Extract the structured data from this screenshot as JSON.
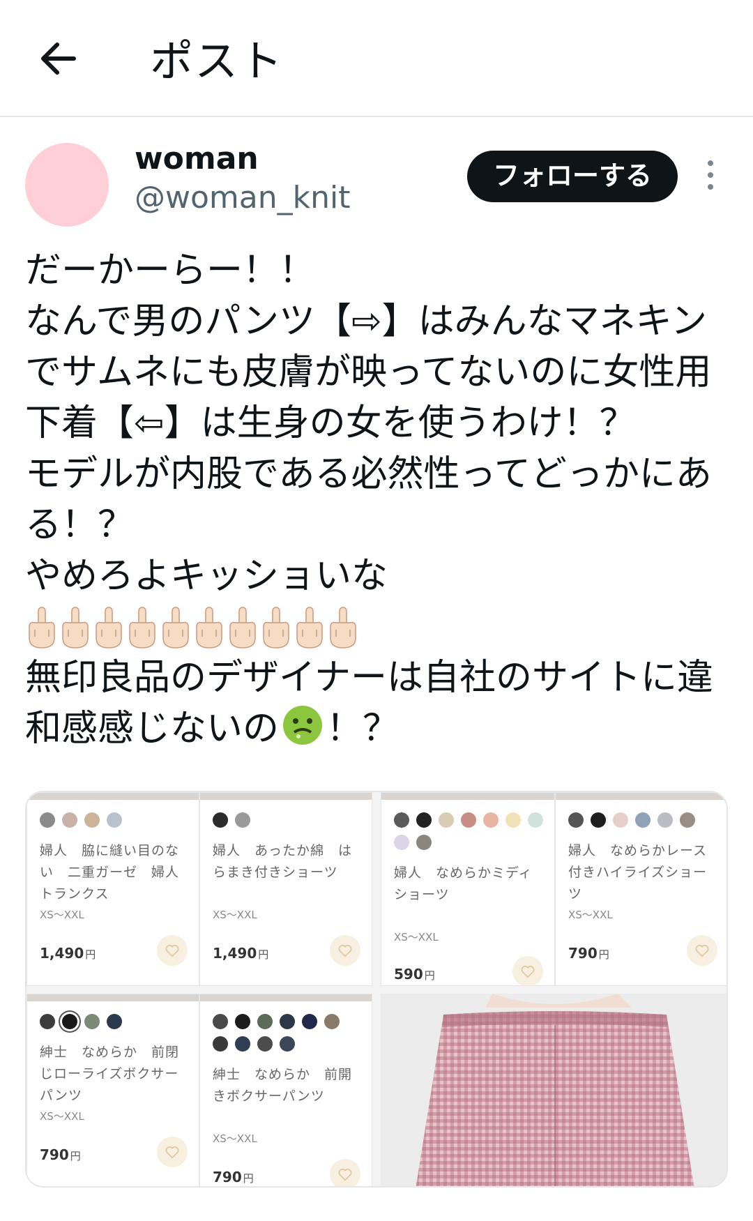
{
  "header": {
    "title": "ポスト",
    "back_icon": "arrow-left-icon"
  },
  "author": {
    "display_name": "woman",
    "handle": "@woman_knit",
    "avatar_color": "#ffcfd8"
  },
  "actions": {
    "follow_label": "フォローする",
    "more_icon": "more-vertical-icon"
  },
  "post": {
    "lines": [
      "だーかーらー！！",
      "なんで男のパンツ【⇨】はみんなマネキン",
      "でサムネにも皮膚が映ってないのに女性用",
      "下着【⇦】は生身の女を使うわけ！？",
      "モデルが内股である必然性ってどっかにあ",
      "る！？",
      "やめろよキッショいな"
    ],
    "emoji_line": "🖕🏻🖕🏻🖕🏻🖕🏻🖕🏻🖕🏻🖕🏻🖕🏻🖕🏻🖕🏻",
    "line_after_emoji": "無印良品のデザイナーは自社のサイトに違",
    "last_line_before": "和感感じないの",
    "last_line_emoji": "🤢",
    "last_line_after": "！？"
  },
  "media": {
    "products": [
      {
        "name": "婦人　脇に縫い目のない　二重ガーゼ　婦人トランクス",
        "size": "XS～XXL",
        "price": "1,490",
        "yen": "円",
        "swatches": [
          "#8a8a8a",
          "#c9b2a8",
          "#cdb59b",
          "#b9c2cf"
        ]
      },
      {
        "name": "婦人　あったか綿　はらまき付きショーツ",
        "size": "XS～XXL",
        "price": "1,490",
        "yen": "円",
        "swatches": [
          "#2b2b2b",
          "#9a9a9a"
        ]
      },
      {
        "name": "婦人　なめらかミディショーツ",
        "size": "XS～XXL",
        "price": "590",
        "yen": "円",
        "swatches": [
          "#5a5a5a",
          "#222222",
          "#d9cbb6",
          "#c88e86",
          "#e8b5a5",
          "#f0e2b6",
          "#cfe2dc",
          "#d9d4e6",
          "#8a8580"
        ]
      },
      {
        "name": "婦人　なめらかレース付きハイライズショーツ",
        "size": "XS～XXL",
        "price": "790",
        "yen": "円",
        "swatches": [
          "#555555",
          "#1e1e1e",
          "#e6cfcb",
          "#8fa2b8",
          "#b9bcc4",
          "#9a8d84"
        ]
      },
      {
        "name": "紳士　なめらか　前閉じローライズボクサーパンツ",
        "size": "XS～XXL",
        "price": "790",
        "yen": "円",
        "swatches": [
          "#3c3c3c",
          "#1a1a1a",
          "#7a8a74",
          "#2c3a4e"
        ]
      },
      {
        "name": "紳士　なめらか　前開きボクサーパンツ",
        "size": "XS～XXL",
        "price": "790",
        "yen": "円",
        "swatches": [
          "#4a4a4a",
          "#1c1c1c",
          "#5d6b58",
          "#2c3748",
          "#1f2a4a",
          "#8a7a6a",
          "#3a3a3a",
          "#2f3d55",
          "#4c4c4c",
          "#3b4657"
        ]
      }
    ],
    "photo_alt_colors": {
      "fabric": "#c99aa6",
      "background": "#ececec"
    }
  }
}
